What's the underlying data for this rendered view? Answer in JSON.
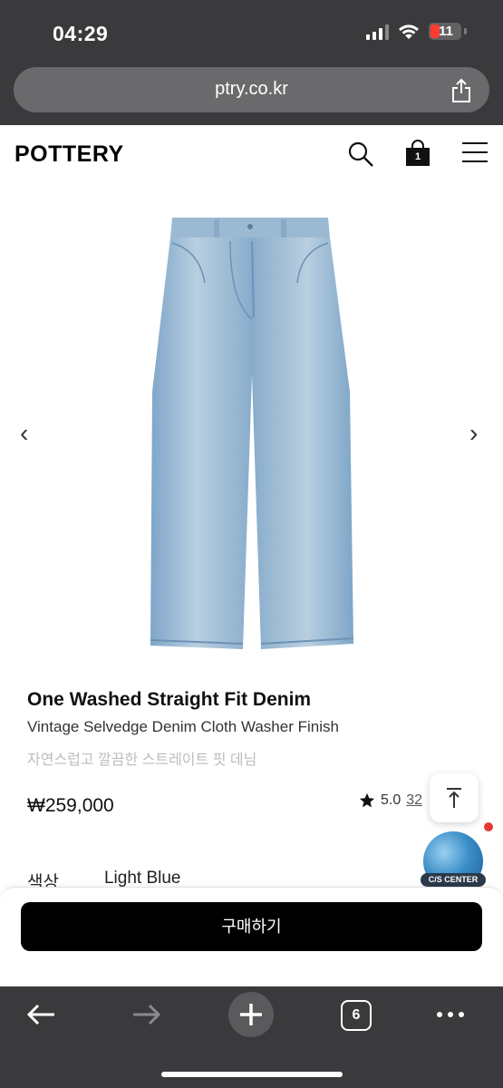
{
  "status_bar": {
    "time": "04:29",
    "battery": "11"
  },
  "browser": {
    "url": "ptry.co.kr",
    "tab_count": "6"
  },
  "site": {
    "logo": "POTTERY",
    "cart_count": "1"
  },
  "product": {
    "name": "One Washed Straight Fit Denim",
    "subtitle": "Vintage Selvedge Denim Cloth Washer Finish",
    "korean_name": "자연스럽고 깔끔한 스트레이트 핏 데님",
    "price": "₩259,000",
    "rating": "5.0",
    "review_count": "32",
    "color_label": "색상",
    "color_value": "Light Blue",
    "image_carousel": {
      "prev_glyph": "‹",
      "next_glyph": "›"
    }
  },
  "purchase": {
    "buy_label": "구매하기"
  },
  "widgets": {
    "cs_label": "C/S CENTER"
  },
  "colors": {
    "chrome": "#3a3a3c",
    "buy_button": "#000000",
    "battery_low": "#ff3b30",
    "denim": "#8fb1cf"
  },
  "icons": [
    "signal-icon",
    "wifi-icon",
    "battery-icon",
    "share-icon",
    "search-icon",
    "cart-icon",
    "menu-icon",
    "chevron-left-icon",
    "chevron-right-icon",
    "star-icon",
    "scroll-top-icon",
    "back-icon",
    "forward-icon",
    "plus-icon",
    "tabs-icon",
    "more-icon"
  ]
}
